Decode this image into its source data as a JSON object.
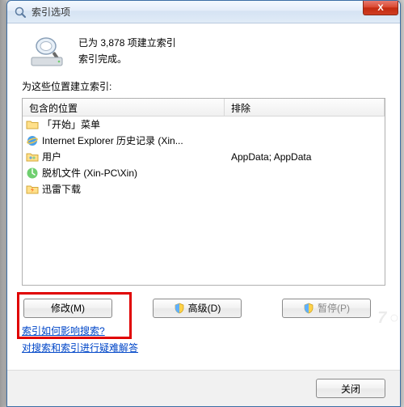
{
  "window": {
    "title": "索引选项"
  },
  "status": {
    "line1": "已为 3,878 项建立索引",
    "line2": "索引完成。"
  },
  "section_label": "为这些位置建立索引:",
  "columns": {
    "c1": "包含的位置",
    "c2": "排除"
  },
  "rows": [
    {
      "icon": "folder",
      "label": "「开始」菜单",
      "exclude": ""
    },
    {
      "icon": "ie",
      "label": "Internet Explorer 历史记录 (Xin...",
      "exclude": ""
    },
    {
      "icon": "users",
      "label": "用户",
      "exclude": "AppData; AppData"
    },
    {
      "icon": "offline",
      "label": "脱机文件 (Xin-PC\\Xin)",
      "exclude": ""
    },
    {
      "icon": "thunder",
      "label": "迅雷下载",
      "exclude": ""
    }
  ],
  "buttons": {
    "modify": "修改(M)",
    "advanced": "高级(D)",
    "pause": "暂停(P)",
    "close": "关闭"
  },
  "links": {
    "l1": "索引如何影响搜索?",
    "l2": "对搜索和索引进行疑难解答"
  },
  "close_x": "X"
}
